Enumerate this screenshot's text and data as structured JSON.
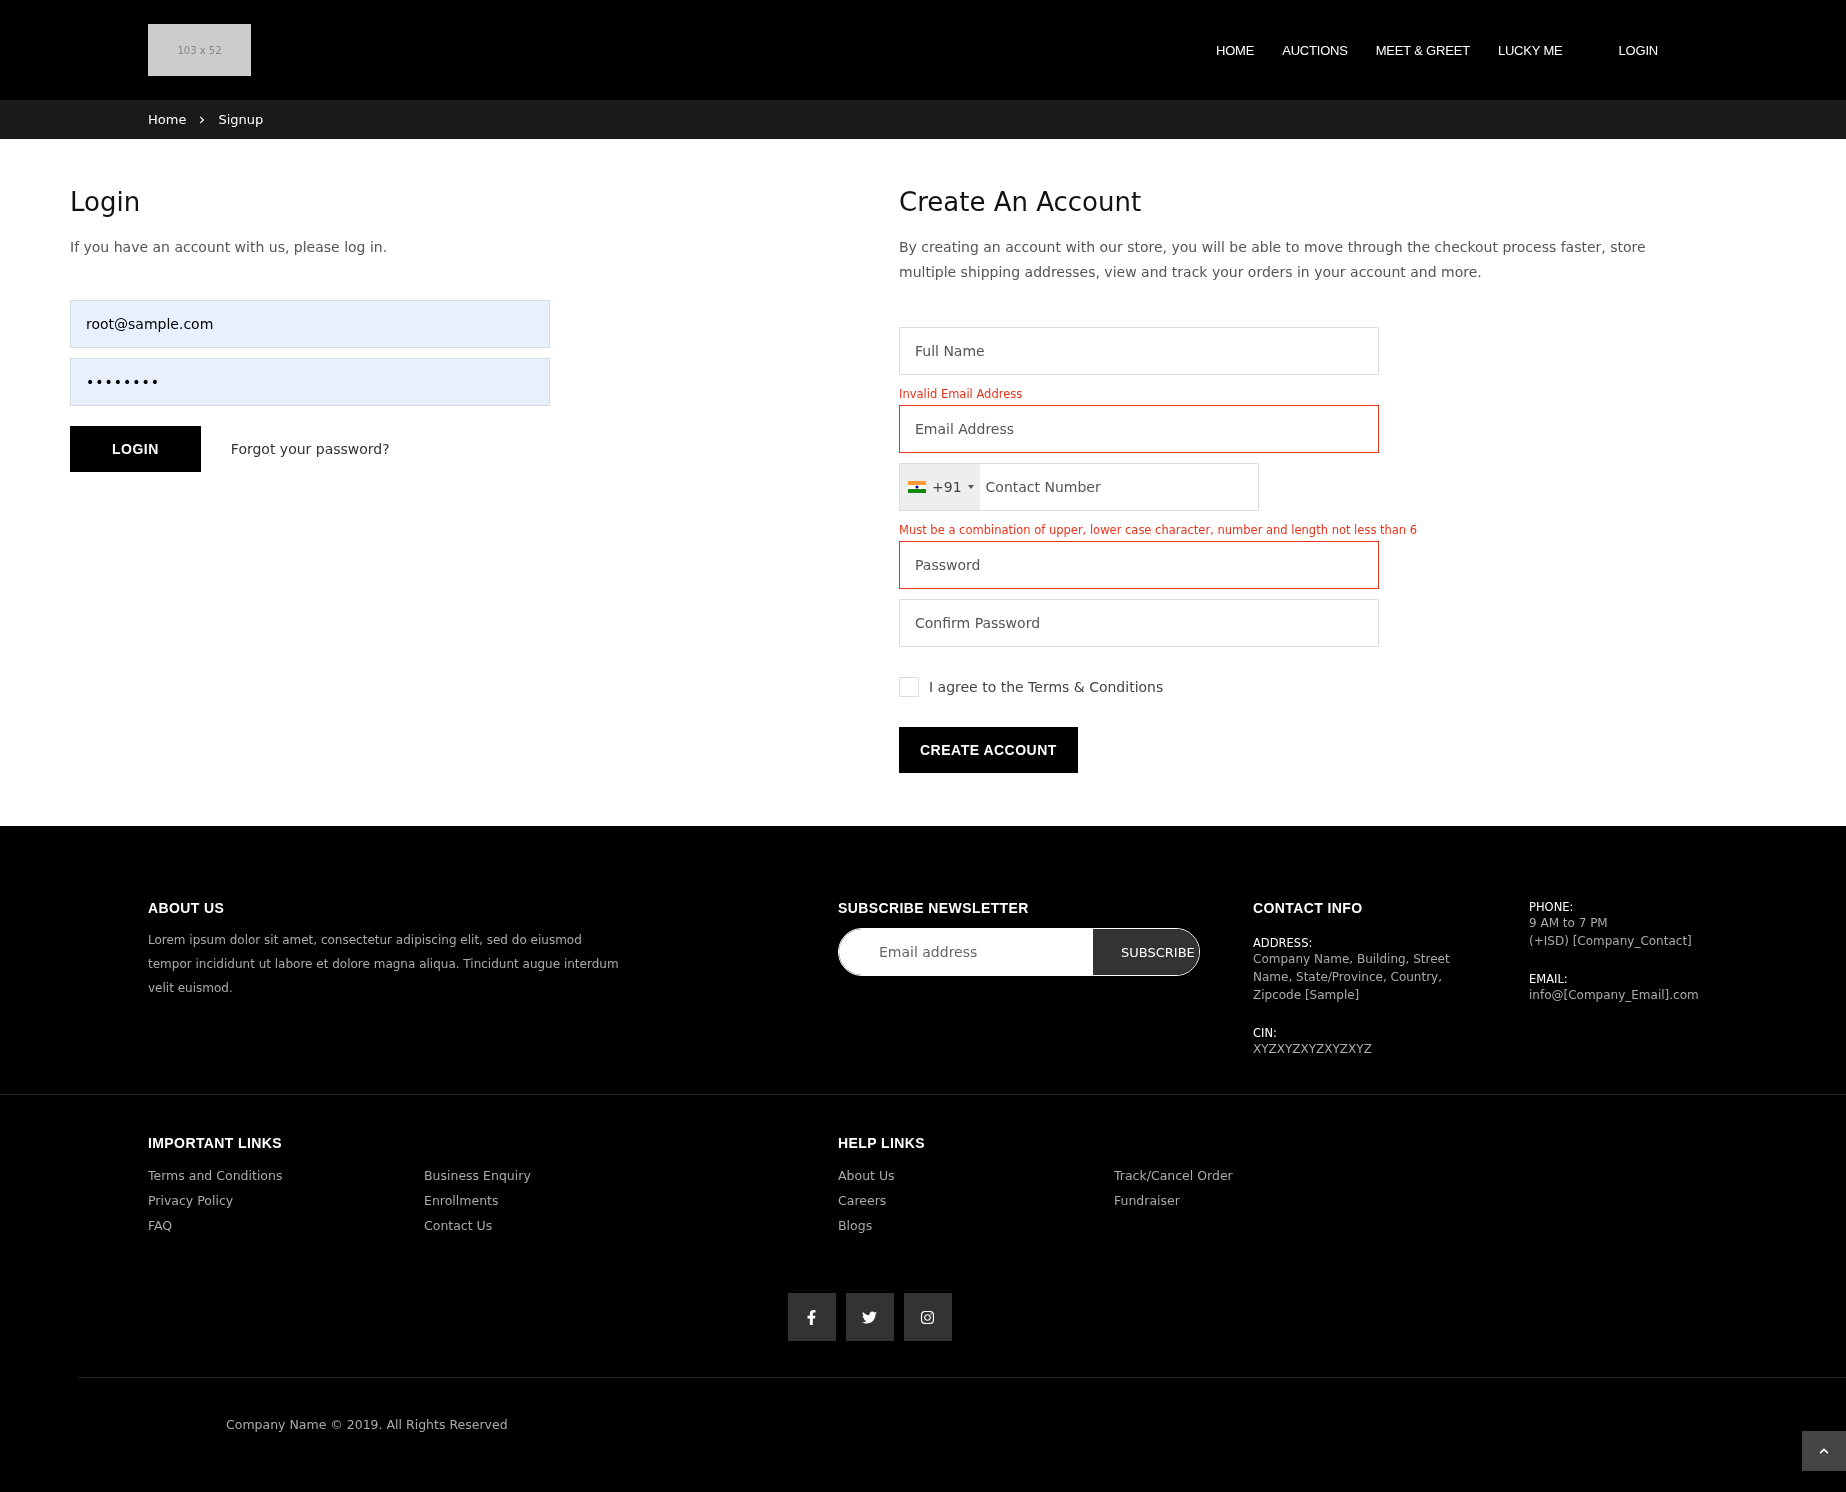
{
  "header": {
    "logo": "103 x 52",
    "nav": [
      "HOME",
      "AUCTIONS",
      "MEET & GREET",
      "LUCKY ME"
    ],
    "login": "LOGIN"
  },
  "breadcrumb": [
    "Home",
    "Signup"
  ],
  "login": {
    "title": "Login",
    "intro": "If you have an account with us, please log in.",
    "fields": [
      {
        "kind": "text",
        "value": "root@sample.com"
      },
      {
        "kind": "password",
        "value": "••••••••"
      }
    ],
    "button": "LOGIN",
    "forgot": "Forgot your password?"
  },
  "signup": {
    "title": "Create An Account",
    "intro": "By creating an account with our store, you will be able to move through the checkout process faster, store multiple shipping addresses, view and track your orders in your account and more.",
    "fields": [
      {
        "kind": "text",
        "placeholder": "Full Name",
        "invalid": false
      },
      {
        "kind": "text",
        "placeholder": "Email Address",
        "invalid": true,
        "error": "Invalid Email Address"
      },
      {
        "kind": "phone",
        "code": "+91",
        "placeholder": "Contact Number",
        "invalid": false
      },
      {
        "kind": "password",
        "placeholder": "Password",
        "invalid": true,
        "error": "Must be a combination of upper, lower case character, number and length not less than 6"
      },
      {
        "kind": "password",
        "placeholder": "Confirm Password",
        "invalid": false
      }
    ],
    "agree": {
      "label": "I agree to the Terms & Conditions",
      "checked": false
    },
    "button": "CREATE ACCOUNT"
  },
  "footer": {
    "about": {
      "title": "ABOUT US",
      "text": "Lorem ipsum dolor sit amet, consectetur adipiscing elit, sed do eiusmod tempor incididunt ut labore et dolore magna aliqua. Tincidunt augue interdum velit euismod."
    },
    "newsletter": {
      "title": "SUBSCRIBE NEWSLETTER",
      "placeholder": "Email address",
      "button": "SUBSCRIBE"
    },
    "contact": {
      "title": "CONTACT INFO",
      "columns": [
        [
          {
            "label": "ADDRESS:",
            "lines": [
              "Company Name, Building, Street Name, State/Province, Country, Zipcode [Sample]"
            ]
          },
          {
            "label": "CIN:",
            "lines": [
              "XYZXYZXYZXYZXYZ"
            ]
          }
        ],
        [
          {
            "label": "PHONE:",
            "lines": [
              "9 AM to 7 PM",
              "(+ISD) [Company_Contact]"
            ]
          },
          {
            "label": "EMAIL:",
            "lines": [
              "info@[Company_Email].com"
            ]
          }
        ]
      ]
    },
    "link_groups": [
      {
        "title": "IMPORTANT LINKS",
        "columns": [
          [
            "Terms and Conditions",
            "Privacy Policy",
            "FAQ"
          ],
          [
            "Business Enquiry",
            "Enrollments",
            "Contact Us"
          ]
        ]
      },
      {
        "title": "HELP LINKS",
        "columns": [
          [
            "About Us",
            "Careers",
            "Blogs"
          ],
          [
            "Track/Cancel Order",
            "Fundraiser"
          ]
        ]
      }
    ],
    "social": [
      {
        "kind": "facebook"
      },
      {
        "kind": "twitter"
      },
      {
        "kind": "instagram"
      }
    ],
    "copyright": "Company Name © 2019. All Rights Reserved"
  }
}
